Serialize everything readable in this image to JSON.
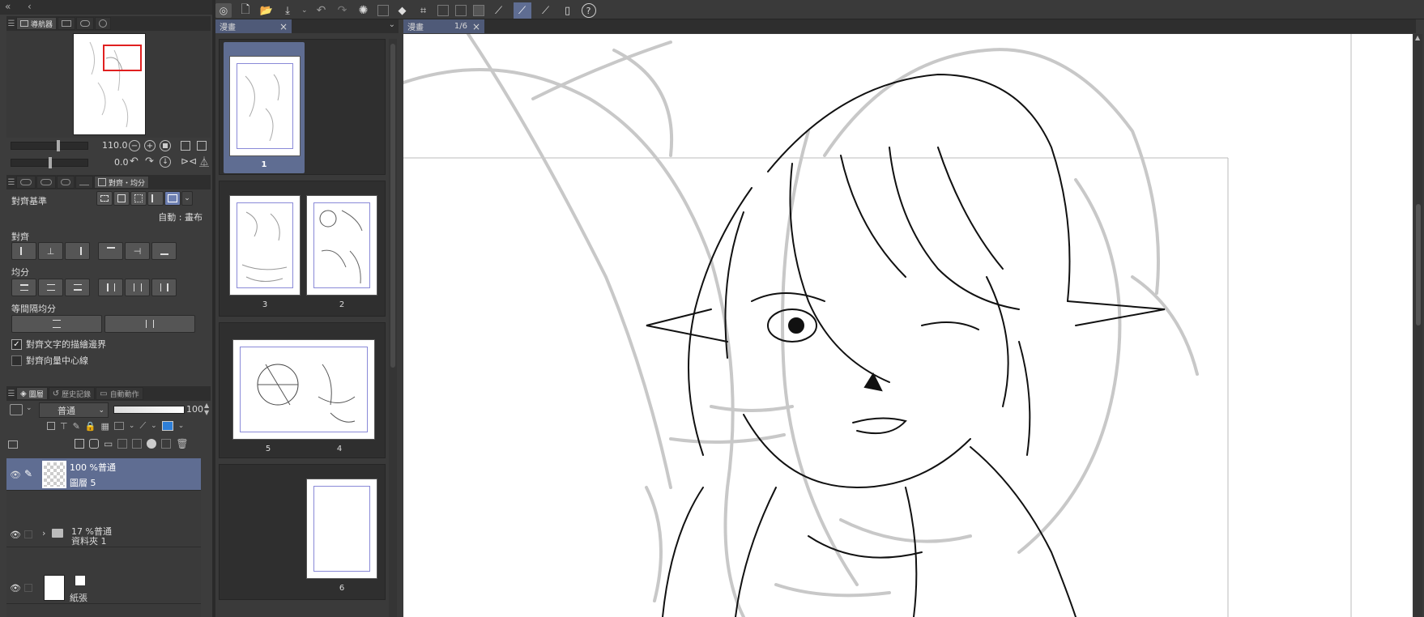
{
  "navigator": {
    "tab_label": "導航器",
    "zoom_value": "110.0",
    "rotation_value": "0.0"
  },
  "align_panel": {
    "tab_label": "對齊・均分",
    "align_base_label": "對齊基準",
    "align_base_value": "自動 : 畫布",
    "align_label": "對齊",
    "distribute_label": "均分",
    "equal_spacing_label": "等間隔均分",
    "check_text_border_label": "對齊文字的描繪邊界",
    "check_text_border_checked": true,
    "check_vector_center_label": "對齊向量中心線",
    "check_vector_center_checked": false
  },
  "layer_panel": {
    "tabs": [
      "圖層",
      "歷史記錄",
      "自動動作"
    ],
    "blend_mode": "普通",
    "opacity": "100",
    "layers": [
      {
        "info": "100 %普通",
        "name": "圖層 5",
        "type": "raster",
        "selected": true
      },
      {
        "info": "17 %普通",
        "name": "資料夾 1",
        "type": "folder",
        "selected": false
      },
      {
        "info": "",
        "name": "紙張",
        "type": "paper",
        "selected": false
      }
    ]
  },
  "page_panel": {
    "tab_label": "漫畫",
    "pages": [
      {
        "number": "1",
        "selected": true
      },
      {
        "number": "3"
      },
      {
        "number": "2"
      },
      {
        "number": "5"
      },
      {
        "number": "4"
      },
      {
        "number": "6"
      }
    ]
  },
  "canvas": {
    "tab_label": "漫畫",
    "page_indicator": "1/6"
  }
}
